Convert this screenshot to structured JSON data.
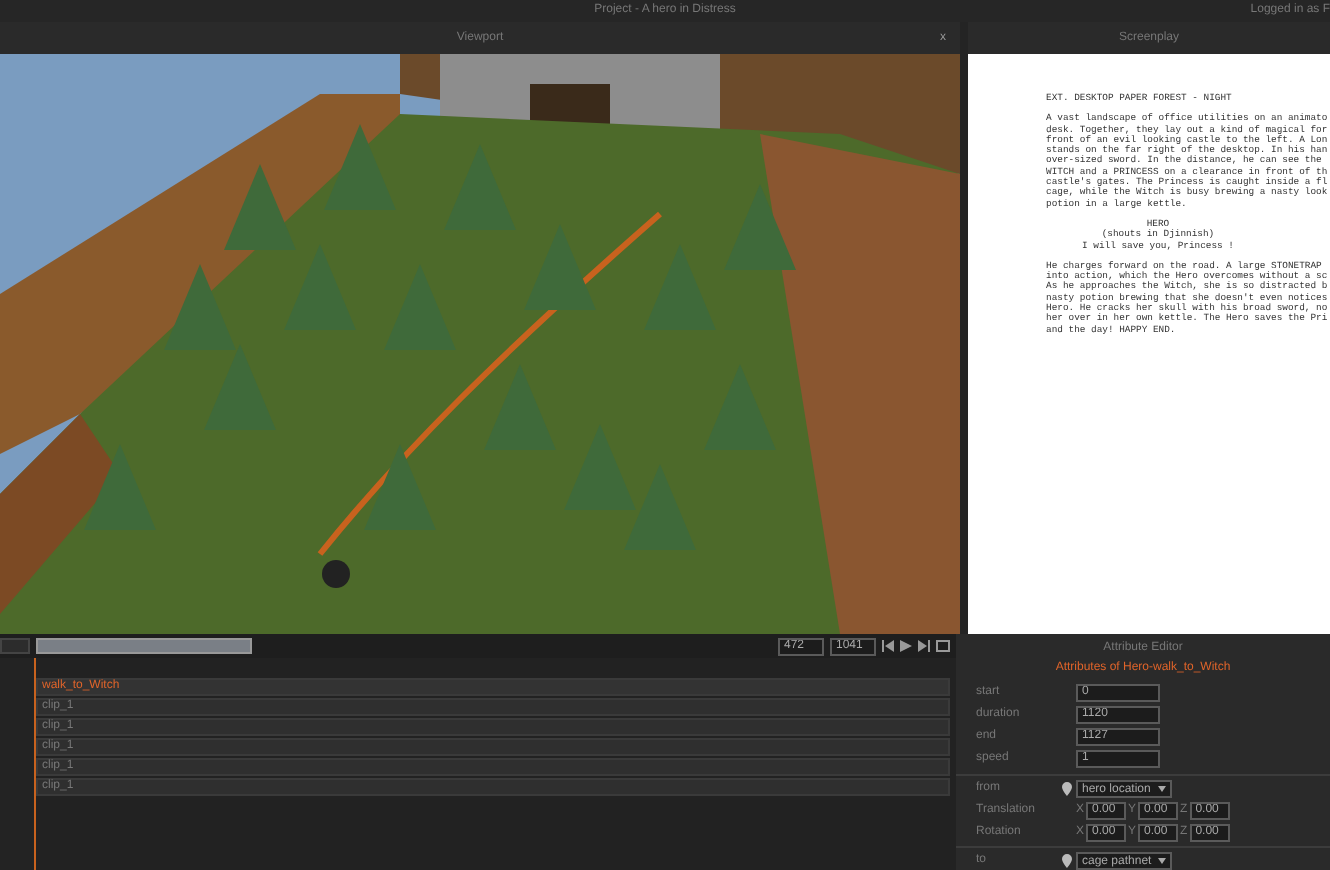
{
  "window": {
    "title": "Project - A hero in Distress",
    "user": "Logged in as F"
  },
  "viewport": {
    "title": "Viewport",
    "close": "x"
  },
  "screenplay": {
    "title": "Screenplay",
    "lines": [
      {
        "kind": "heading",
        "text": "EXT. DESKTOP PAPER FOREST - NIGHT"
      },
      {
        "kind": "action",
        "text": "A vast landscape of office utilities on an animato"
      },
      {
        "kind": "action",
        "text": "desk. Together, they lay out a kind of magical for"
      },
      {
        "kind": "action",
        "text": "front of an evil looking castle to the left. A Lon"
      },
      {
        "kind": "action",
        "text": "stands on the far right of the desktop. In his han"
      },
      {
        "kind": "action",
        "text": "over-sized sword. In the distance, he can see the"
      },
      {
        "kind": "action",
        "text": "WITCH and a PRINCESS on a clearance in front of th"
      },
      {
        "kind": "action",
        "text": "castle's gates. The Princess is caught inside a fl"
      },
      {
        "kind": "action",
        "text": "cage, while the Witch is busy brewing a nasty look"
      },
      {
        "kind": "action",
        "text": "potion in a large kettle."
      },
      {
        "kind": "character",
        "text": "HERO"
      },
      {
        "kind": "parenthetical",
        "text": "(shouts in Djinnish)"
      },
      {
        "kind": "dialogue",
        "text": "I will save you, Princess !"
      },
      {
        "kind": "action",
        "text": "He charges forward on the road. A large STONETRAP"
      },
      {
        "kind": "action",
        "text": "into action, which the Hero overcomes without a sc"
      },
      {
        "kind": "action",
        "text": "As he approaches the Witch, she is so distracted b"
      },
      {
        "kind": "action",
        "text": "nasty potion brewing that she doesn't even notices"
      },
      {
        "kind": "action",
        "text": "Hero. He cracks her skull with his broad sword, no"
      },
      {
        "kind": "action",
        "text": "her over in her own kettle. The Hero saves the Pri"
      },
      {
        "kind": "action",
        "text": "and the day! HAPPY END."
      }
    ]
  },
  "timeline": {
    "frame_start": "472",
    "frame_end": "1041",
    "tracks": [
      {
        "label": "walk_to_Witch",
        "selected": true
      },
      {
        "label": "clip_1",
        "selected": false
      },
      {
        "label": "clip_1",
        "selected": false
      },
      {
        "label": "clip_1",
        "selected": false
      },
      {
        "label": "clip_1",
        "selected": false
      },
      {
        "label": "clip_1",
        "selected": false
      }
    ]
  },
  "attribute_editor": {
    "title": "Attribute Editor",
    "subtitle": "Attributes of Hero-walk_to_Witch",
    "fields": [
      {
        "label": "start",
        "value": "0"
      },
      {
        "label": "duration",
        "value": "1120"
      },
      {
        "label": "end",
        "value": "1127"
      },
      {
        "label": "speed",
        "value": "1"
      }
    ],
    "from": {
      "label": "from",
      "value": "hero location"
    },
    "vectors": [
      {
        "label": "Translation",
        "values": [
          {
            "axis": "X",
            "value": "0.00"
          },
          {
            "axis": "Y",
            "value": "0.00"
          },
          {
            "axis": "Z",
            "value": "0.00"
          }
        ]
      },
      {
        "label": "Rotation",
        "values": [
          {
            "axis": "X",
            "value": "0.00"
          },
          {
            "axis": "Y",
            "value": "0.00"
          },
          {
            "axis": "Z",
            "value": "0.00"
          }
        ]
      }
    ],
    "to": {
      "label": "to",
      "value": "cage pathnet"
    }
  }
}
